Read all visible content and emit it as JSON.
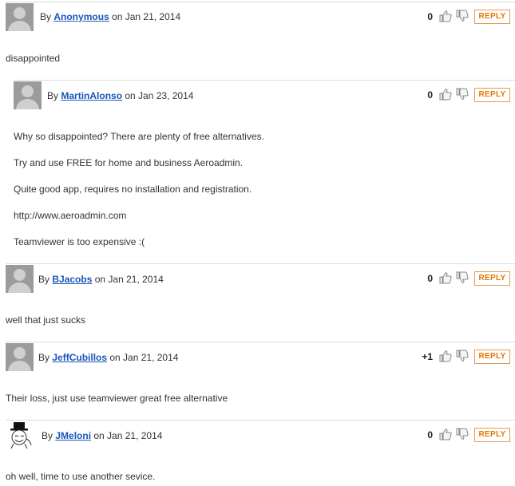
{
  "comments": [
    {
      "by_prefix": "By",
      "author": "Anonymous",
      "date": "on Jan 21, 2014",
      "score": "0",
      "reply_label": "REPLY",
      "lines": [
        "disappointed"
      ]
    },
    {
      "by_prefix": "By",
      "author": "MartinAlonso",
      "date": "on Jan 23, 2014",
      "score": "0",
      "reply_label": "REPLY",
      "lines": [
        "Why so disappointed? There are plenty of free alternatives.",
        "Try and use FREE for home and business Aeroadmin.",
        "Quite good app, requires no installation and registration.",
        "http://www.aeroadmin.com",
        "Teamviewer is too expensive :("
      ]
    },
    {
      "by_prefix": "By",
      "author": "BJacobs",
      "date": "on Jan 21, 2014",
      "score": "0",
      "reply_label": "REPLY",
      "lines": [
        "well that just sucks"
      ]
    },
    {
      "by_prefix": "By",
      "author": "JeffCubillos",
      "date": "on Jan 21, 2014",
      "score": "+1",
      "reply_label": "REPLY",
      "lines": [
        "Their loss, just use teamviewer great free alternative"
      ]
    },
    {
      "by_prefix": "By",
      "author": "JMeloni",
      "date": "on Jan 21, 2014",
      "score": "0",
      "reply_label": "REPLY",
      "lines": [
        "oh well, time to use another sevice."
      ]
    }
  ]
}
